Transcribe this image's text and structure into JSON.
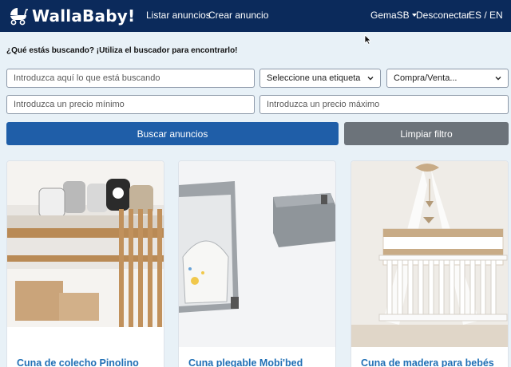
{
  "navbar": {
    "brand": "WallaBaby!",
    "links": {
      "list_ads": "Listar anuncios",
      "create_ad": "Crear anuncio",
      "user": "GemaSB",
      "logout": "Desconectar",
      "language": "ES / EN"
    }
  },
  "search": {
    "heading": "¿Qué estás buscando? ¡Utiliza el buscador para encontrarlo!",
    "query_placeholder": "Introduzca aquí lo que está buscando",
    "tag_select": "Seleccione una etiqueta",
    "type_select": "Compra/Venta...",
    "min_price_placeholder": "Introduzca un precio mínimo",
    "max_price_placeholder": "Introduzca un precio máximo",
    "search_button": "Buscar anuncios",
    "clear_button": "Limpiar filtro"
  },
  "ads": [
    {
      "title": "Cuna de colecho Pinolino"
    },
    {
      "title": "Cuna plegable Mobi'bed"
    },
    {
      "title": "Cuna de madera para bebés"
    }
  ],
  "colors": {
    "navbar": "#0b2a5b",
    "page_background": "#e8f1f7",
    "primary_button": "#1f5ea8",
    "secondary_button": "#6c737a",
    "card_title": "#1f6fb5"
  },
  "icons": {
    "brand": "baby-stroller-icon",
    "user_menu": "caret-down-icon",
    "select": "chevron-down-icon"
  }
}
